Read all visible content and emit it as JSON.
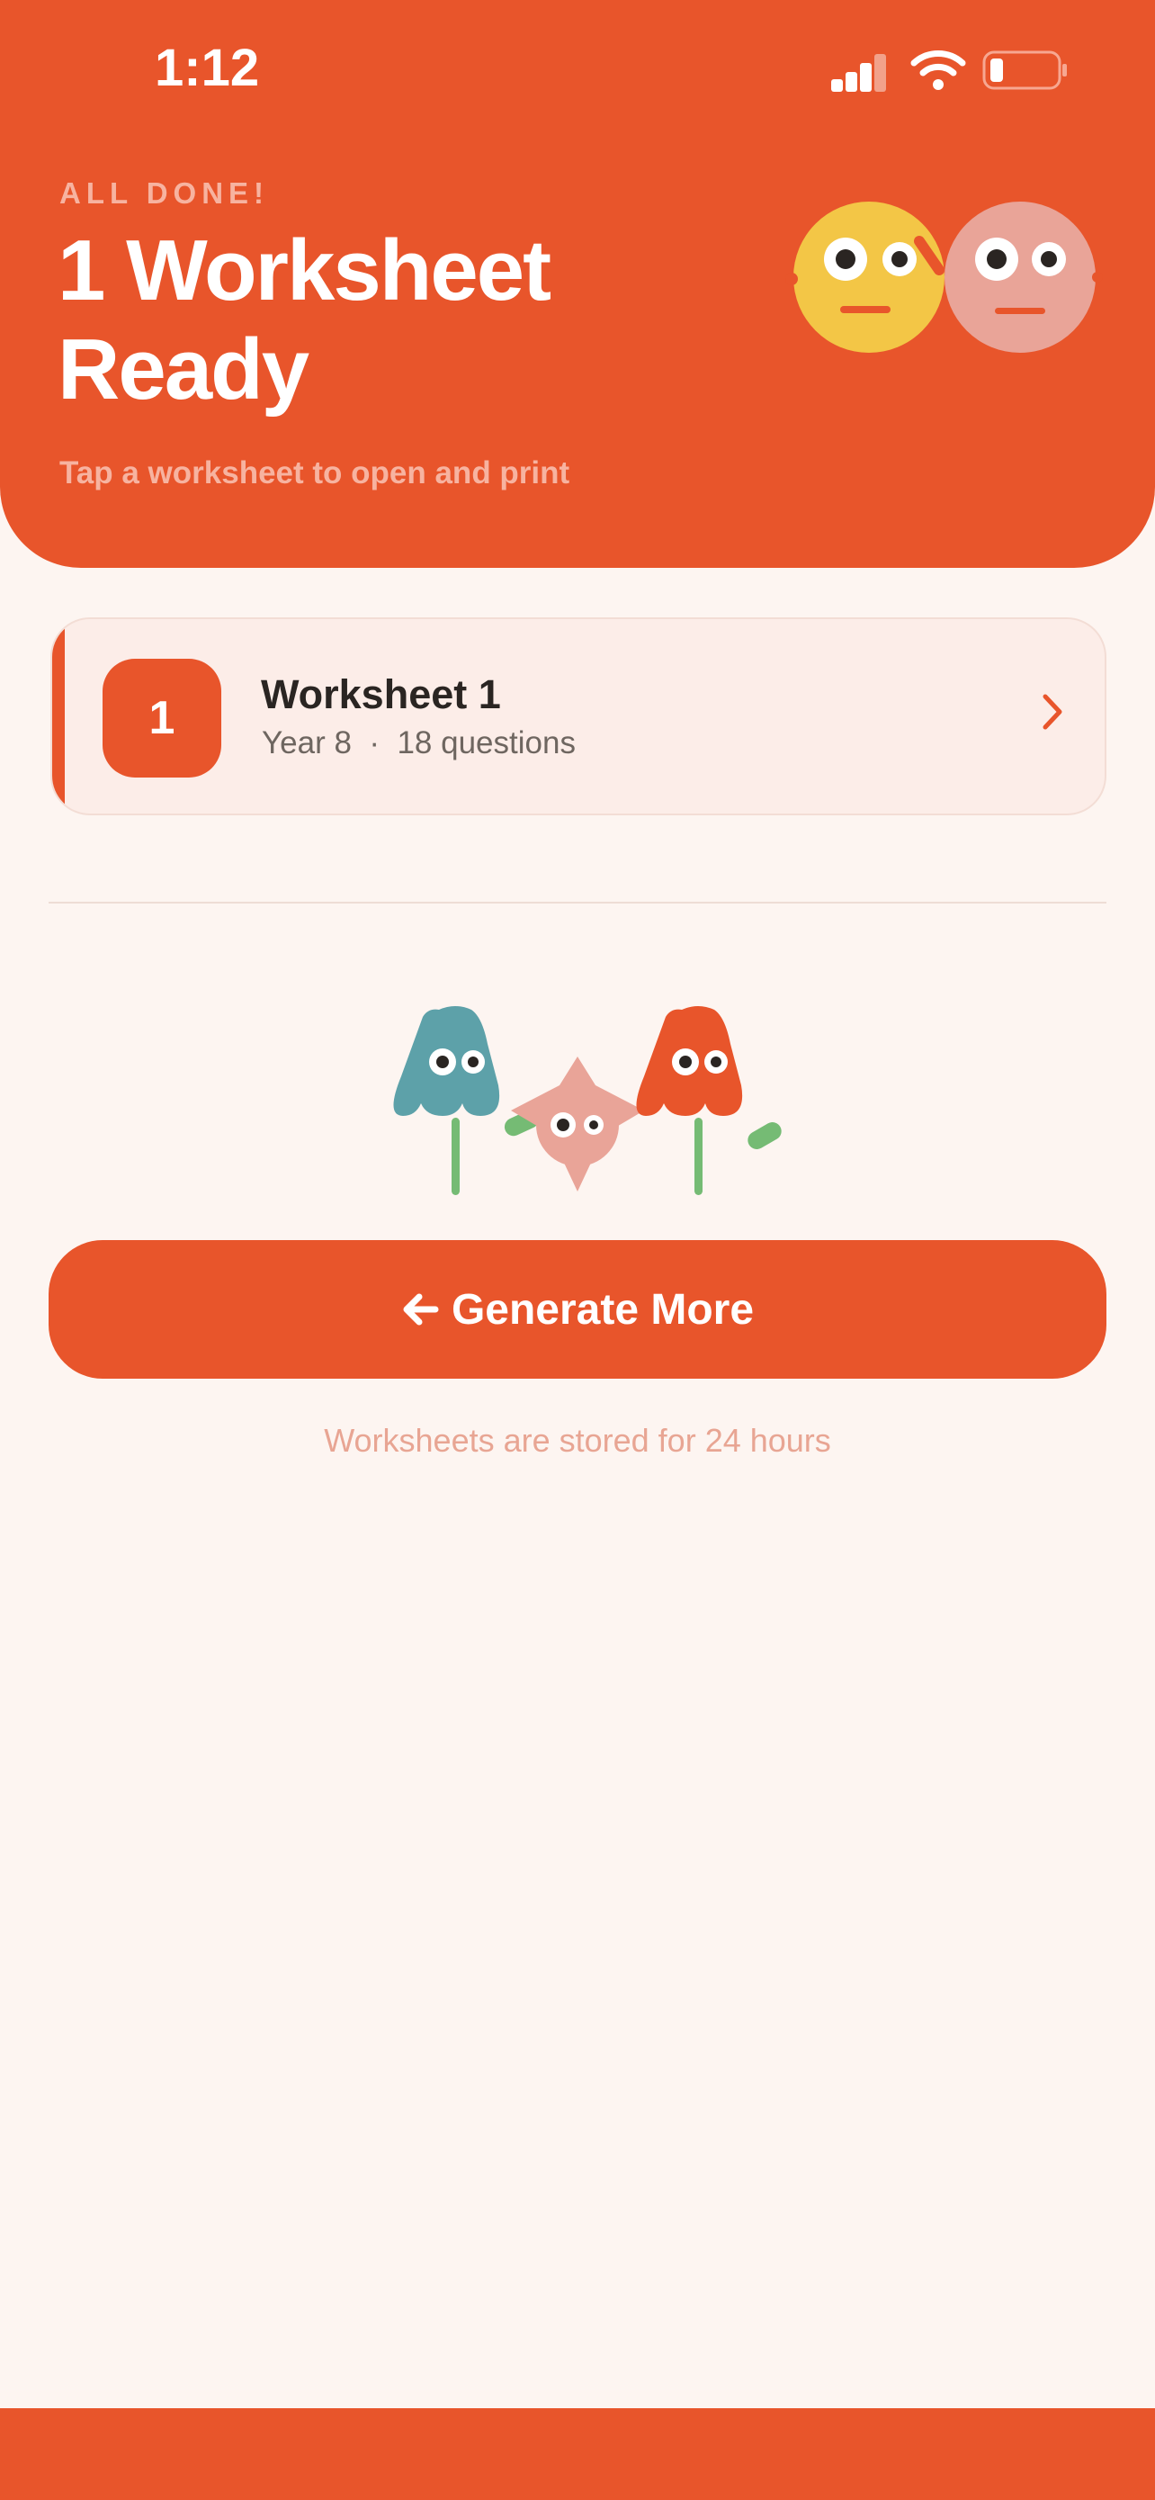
{
  "status_bar": {
    "time": "1:12"
  },
  "header": {
    "eyebrow": "ALL DONE!",
    "title": "1 Worksheet Ready",
    "subtitle": "Tap a worksheet to open and print"
  },
  "worksheets": [
    {
      "number": "1",
      "title": "Worksheet 1",
      "meta": "Year 8  ·  18 questions"
    }
  ],
  "actions": {
    "generate_more_label": "Generate More"
  },
  "footnote": "Worksheets are stored for 24 hours",
  "colors": {
    "primary": "#E8552B",
    "background": "#FDF5F1",
    "card_bg": "#FCEDE8",
    "face_yellow": "#F3C646",
    "face_pink": "#E9A498",
    "monster_teal": "#5DA1A9",
    "stem_green": "#75BB74"
  },
  "icons": [
    "signal-icon",
    "wifi-icon",
    "battery-icon",
    "chevron-right-icon",
    "arrow-left-icon"
  ]
}
